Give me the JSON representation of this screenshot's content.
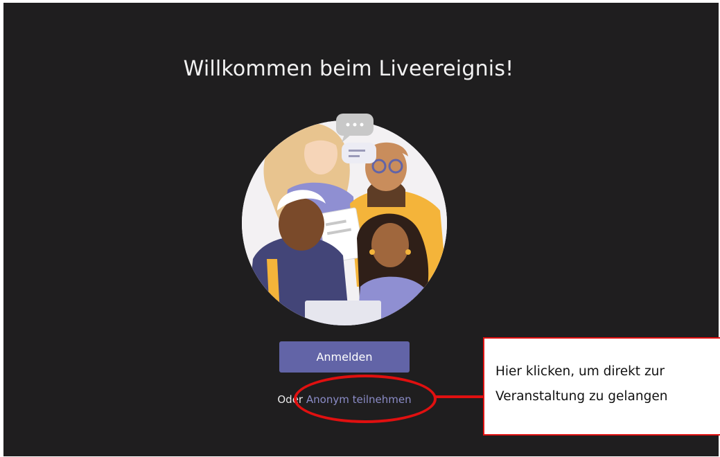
{
  "welcome": {
    "title": "Willkommen beim Liveereignis!"
  },
  "actions": {
    "sign_in_label": "Anmelden",
    "or_label": "Oder",
    "anonymous_label": "Anonym teilnehmen"
  },
  "annotation": {
    "line1": "Hier klicken, um direkt zur",
    "line2": "Veranstaltung zu gelangen",
    "color": "#e01010"
  },
  "colors": {
    "background": "#1f1e1f",
    "accent": "#6264a7",
    "link": "#8b8cc7"
  },
  "icons": [
    "people-illustration"
  ]
}
